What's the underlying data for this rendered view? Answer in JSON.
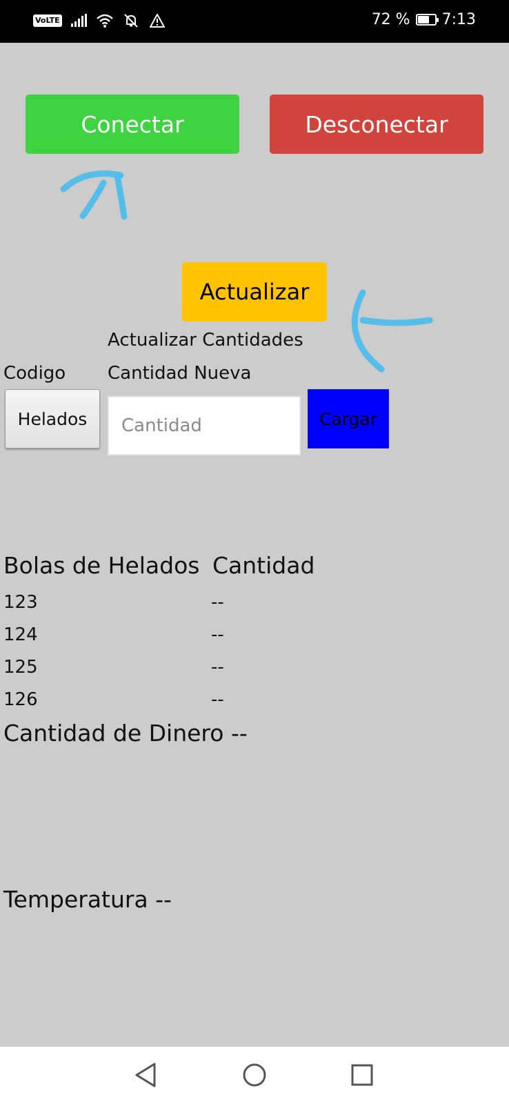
{
  "status_bar": {
    "volte": "VoLTE",
    "battery_percent": "72 %",
    "battery_level": 0.72,
    "time": "7:13",
    "icons": [
      "signal-icon",
      "wifi-icon",
      "notifications-off-icon",
      "warning-icon",
      "battery-icon"
    ]
  },
  "buttons": {
    "connect": "Conectar",
    "disconnect": "Desconectar",
    "update": "Actualizar"
  },
  "colors": {
    "background": "#cccccc",
    "connect": "#3fd341",
    "disconnect": "#d1443e",
    "update": "#ffc300",
    "cargar": "#0000ff",
    "annotation": "#55bdea"
  },
  "update_section": {
    "title": "Actualizar Cantidades",
    "code_label": "Codigo",
    "new_qty_label": "Cantidad Nueva",
    "code_value": "Helados",
    "qty_placeholder": "Cantidad",
    "load_button": "Cargar"
  },
  "table": {
    "headers": [
      "Bolas de Helados",
      "Cantidad"
    ],
    "rows": [
      {
        "code": "123",
        "qty": "--"
      },
      {
        "code": "124",
        "qty": "--"
      },
      {
        "code": "125",
        "qty": "--"
      },
      {
        "code": "126",
        "qty": "--"
      }
    ]
  },
  "money": "Cantidad de Dinero --",
  "temperature": "Temperatura --"
}
